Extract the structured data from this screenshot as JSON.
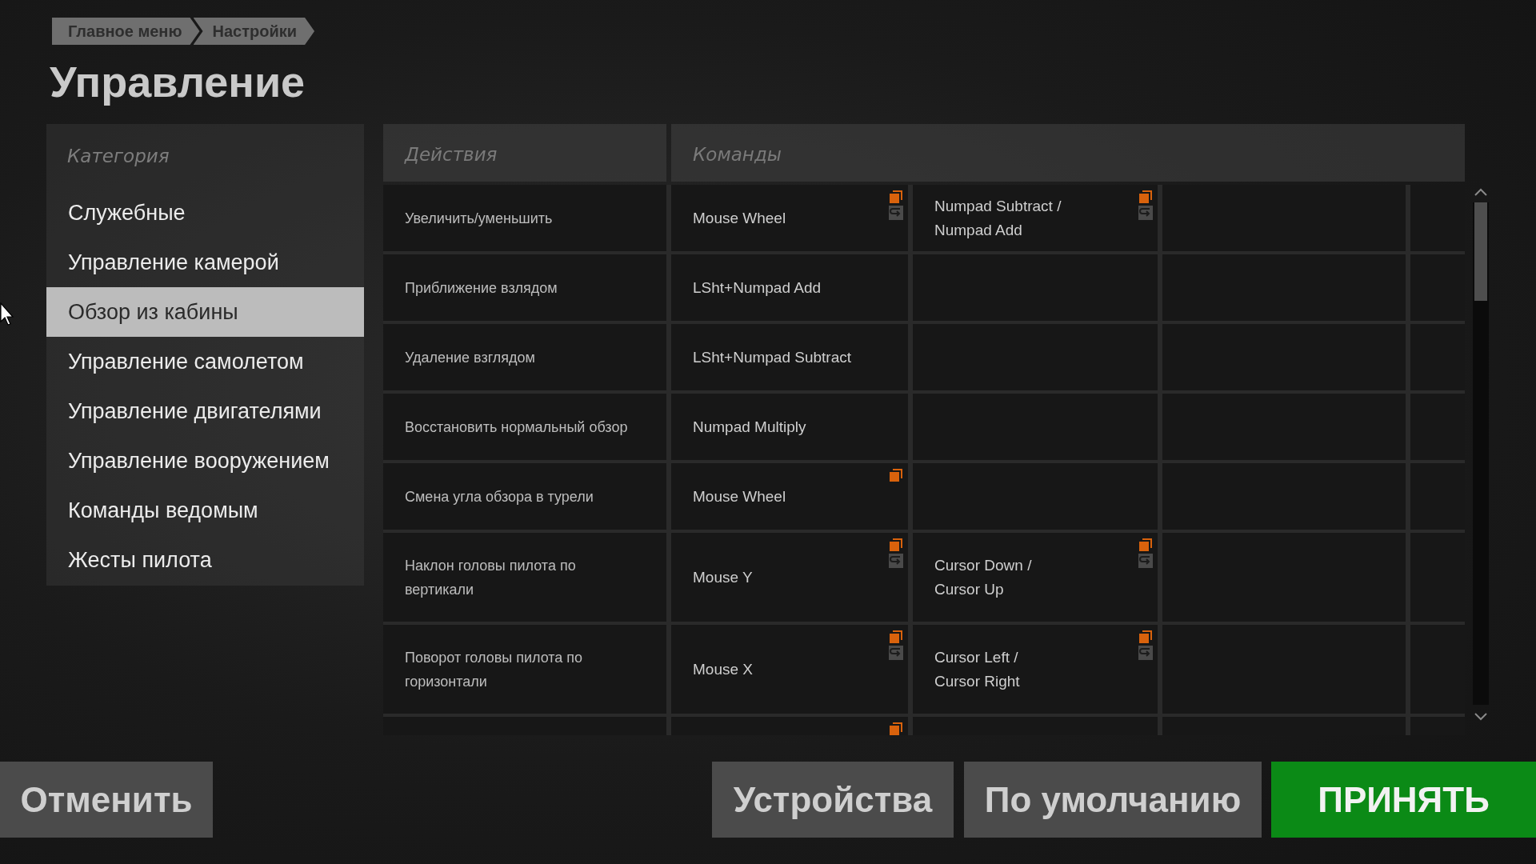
{
  "breadcrumb": [
    "Главное меню",
    "Настройки"
  ],
  "title": "Управление",
  "categories": {
    "header": "Категория",
    "items": [
      {
        "label": "Служебные",
        "selected": false
      },
      {
        "label": "Управление камерой",
        "selected": false
      },
      {
        "label": "Обзор из кабины",
        "selected": true
      },
      {
        "label": "Управление самолетом",
        "selected": false
      },
      {
        "label": "Управление двигателями",
        "selected": false
      },
      {
        "label": "Управление вооружением",
        "selected": false
      },
      {
        "label": "Команды ведомым",
        "selected": false
      },
      {
        "label": "Жесты пилота",
        "selected": false
      }
    ]
  },
  "table": {
    "columns": [
      "Действия",
      "Команды"
    ],
    "rows": [
      {
        "action": "Увеличить/уменьшить",
        "bindings": [
          {
            "text": "Mouse Wheel",
            "copyable": true,
            "resettable": true
          },
          {
            "text": "Numpad Subtract / Numpad Add",
            "copyable": true,
            "resettable": true
          }
        ]
      },
      {
        "action": "Приближение взлядом",
        "bindings": [
          {
            "text": "LSht+Numpad Add",
            "copyable": false,
            "resettable": false
          }
        ]
      },
      {
        "action": "Удаление взглядом",
        "bindings": [
          {
            "text": "LSht+Numpad Subtract",
            "copyable": false,
            "resettable": false
          }
        ]
      },
      {
        "action": "Восстановить нормальный обзор",
        "bindings": [
          {
            "text": "Numpad Multiply",
            "copyable": false,
            "resettable": false
          }
        ]
      },
      {
        "action": "Смена угла обзора в турели",
        "bindings": [
          {
            "text": "Mouse Wheel",
            "copyable": true,
            "resettable": false
          }
        ]
      },
      {
        "action": "Наклон головы пилота по вертикали",
        "bindings": [
          {
            "text": "Mouse Y",
            "copyable": true,
            "resettable": true
          },
          {
            "text": "Cursor Down / Cursor Up",
            "copyable": true,
            "resettable": true
          }
        ]
      },
      {
        "action": "Поворот головы пилота по горизонтали",
        "bindings": [
          {
            "text": "Mouse X",
            "copyable": true,
            "resettable": true
          },
          {
            "text": "Cursor Left / Cursor Right",
            "copyable": true,
            "resettable": true
          }
        ]
      },
      {
        "bindings": [
          {
            "copyable": true,
            "resettable": false
          }
        ]
      }
    ]
  },
  "buttons": [
    {
      "label": "Отменить",
      "kind": "secondary"
    },
    {
      "label": "Устройства",
      "kind": "secondary"
    },
    {
      "label": "По умолчанию",
      "kind": "secondary"
    },
    {
      "label": "ПРИНЯТЬ",
      "kind": "primary"
    }
  ]
}
